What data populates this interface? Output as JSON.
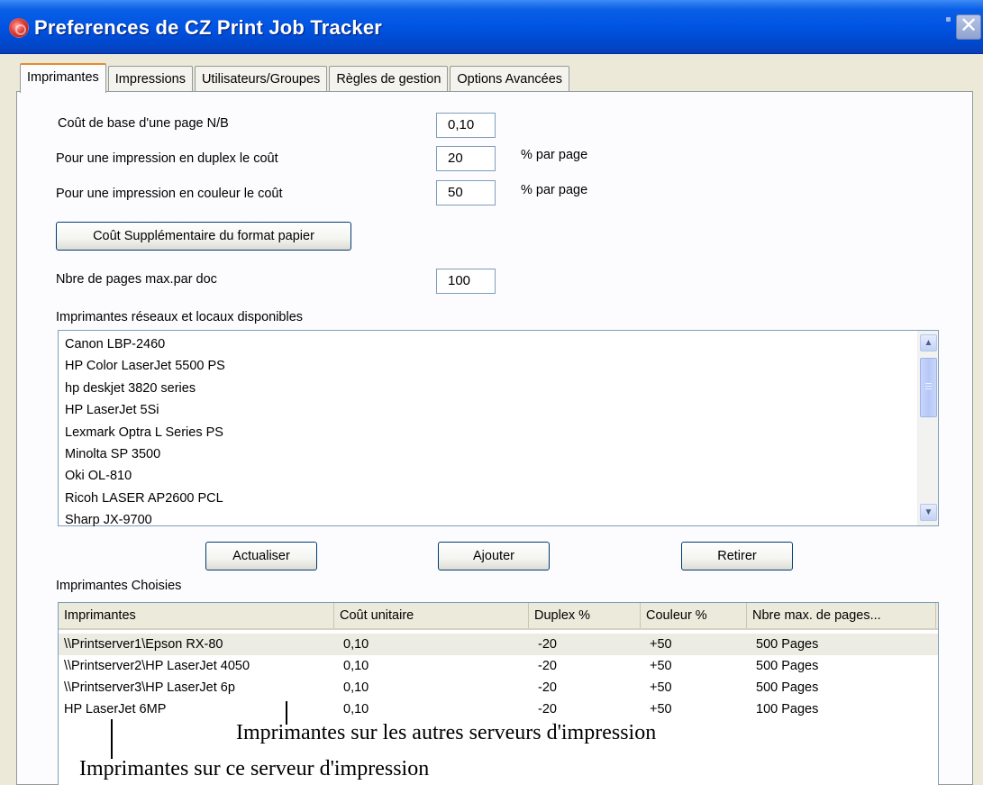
{
  "window": {
    "title": "Preferences de CZ Print Job Tracker",
    "close_glyph": "✕"
  },
  "tabs": [
    {
      "label": "Imprimantes",
      "active": true
    },
    {
      "label": "Impressions",
      "active": false
    },
    {
      "label": "Utilisateurs/Groupes",
      "active": false
    },
    {
      "label": "Règles de gestion",
      "active": false
    },
    {
      "label": "Options Avancées",
      "active": false
    }
  ],
  "settings": {
    "base_cost_label": "Coût de base d'une page N/B",
    "base_cost_value": "0,10",
    "duplex_label": "Pour une impression en duplex le coût",
    "duplex_value": "20",
    "duplex_unit": "% par page",
    "color_label": "Pour une impression en couleur le coût",
    "color_value": "50",
    "color_unit": "% par page",
    "paper_format_button": "Coût Supplémentaire du format papier",
    "max_pages_label": "Nbre de pages max.par doc",
    "max_pages_value": "100"
  },
  "available_printers": {
    "label": "Imprimantes réseaux et locaux disponibles",
    "items": [
      "Canon LBP-2460",
      "HP Color LaserJet 5500 PS",
      "hp deskjet 3820 series",
      "HP LaserJet 5Si",
      "Lexmark Optra L Series PS",
      "Minolta SP 3500",
      "Oki OL-810",
      "Ricoh LASER AP2600 PCL",
      "Sharp JX-9700"
    ]
  },
  "actions": {
    "refresh": "Actualiser",
    "add": "Ajouter",
    "remove": "Retirer"
  },
  "chosen_printers": {
    "label": "Imprimantes Choisies",
    "columns": [
      "Imprimantes",
      "Coût unitaire",
      "Duplex %",
      "Couleur %",
      "Nbre max. de pages..."
    ],
    "rows": [
      [
        "\\\\Printserver1\\Epson RX-80",
        "0,10",
        "-20",
        "+50",
        "500 Pages"
      ],
      [
        "\\\\Printserver2\\HP LaserJet 4050",
        "0,10",
        "-20",
        "+50",
        "500 Pages"
      ],
      [
        "\\\\Printserver3\\HP LaserJet 6p",
        "0,10",
        "-20",
        "+50",
        "500 Pages"
      ],
      [
        "HP LaserJet 6MP",
        "0,10",
        "-20",
        "+50",
        "100 Pages"
      ]
    ]
  },
  "annotations": {
    "other_servers": "Imprimantes sur les autres serveurs d'impression",
    "this_server": "Imprimantes sur ce serveur d'impression"
  },
  "colors": {
    "titlebar": "#0054e3",
    "face": "#ece9d8",
    "active_tab_accent": "#e68b2c"
  }
}
